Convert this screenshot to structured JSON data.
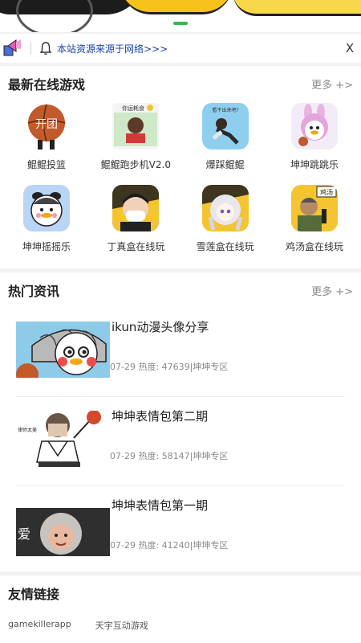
{
  "notice": {
    "text": "本站资源来源于网络>>>",
    "close": "X"
  },
  "latest_games": {
    "title": "最新在线游戏",
    "more": "更多 +>",
    "items": [
      {
        "label": "鲲鲲投篮",
        "icon_text": "开团"
      },
      {
        "label": "鲲鲲跑步机V2.0",
        "icon_text": "你运耗食"
      },
      {
        "label": "爆踩鲲鲲",
        "icon_text": "看不出来吧?"
      },
      {
        "label": "坤坤跳跳乐"
      },
      {
        "label": "坤坤摇摇乐"
      },
      {
        "label": "丁真盒在线玩"
      },
      {
        "label": "雪莲盒在线玩"
      },
      {
        "label": "鸡汤盒在线玩",
        "icon_text": "鸡汤"
      }
    ]
  },
  "hot_news": {
    "title": "热门资讯",
    "more": "更多 +>",
    "items": [
      {
        "title": "ikun动漫头像分享",
        "meta": "07-29  热度: 47639|坤坤专区"
      },
      {
        "title": "坤坤表情包第二期",
        "meta": "07-29  热度: 58147|坤坤专区",
        "thumb_text": "律师太美"
      },
      {
        "title": "坤坤表情包第一期",
        "meta": "07-29  热度: 41240|坤坤专区",
        "thumb_text": "爱"
      }
    ]
  },
  "friend_links": {
    "title": "友情链接",
    "items": [
      "gamekillerapp",
      "天宇互动游戏"
    ]
  }
}
